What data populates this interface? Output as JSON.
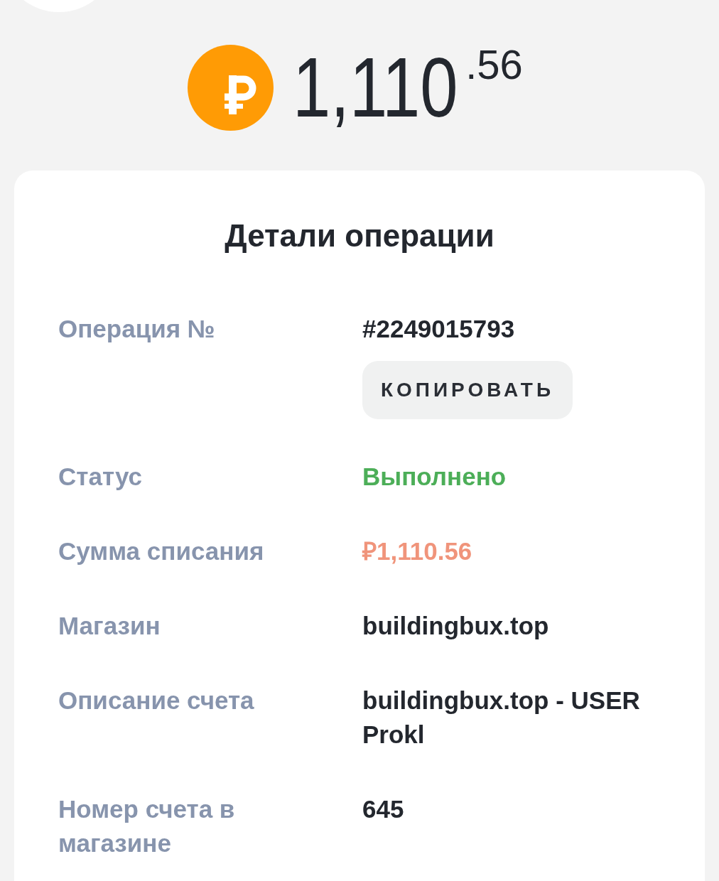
{
  "header": {
    "amount": "1,110",
    "fraction": ".56"
  },
  "details": {
    "title": "Детали операции",
    "rows": [
      {
        "kind": "text",
        "label": "Операция №",
        "value": "#2249015793",
        "button": "КОПИРОВАТЬ"
      },
      {
        "kind": "status",
        "label": "Статус",
        "value": "Выполнено"
      },
      {
        "kind": "amount",
        "label": "Сумма списания",
        "value": "₽1,110.56"
      },
      {
        "kind": "text",
        "label": "Магазин",
        "value": "buildingbux.top"
      },
      {
        "kind": "text",
        "label": "Описание счета",
        "value": "buildingbux.top - USER Prokl"
      },
      {
        "kind": "text",
        "label": "Номер счета в магазине",
        "value": "645"
      }
    ]
  }
}
